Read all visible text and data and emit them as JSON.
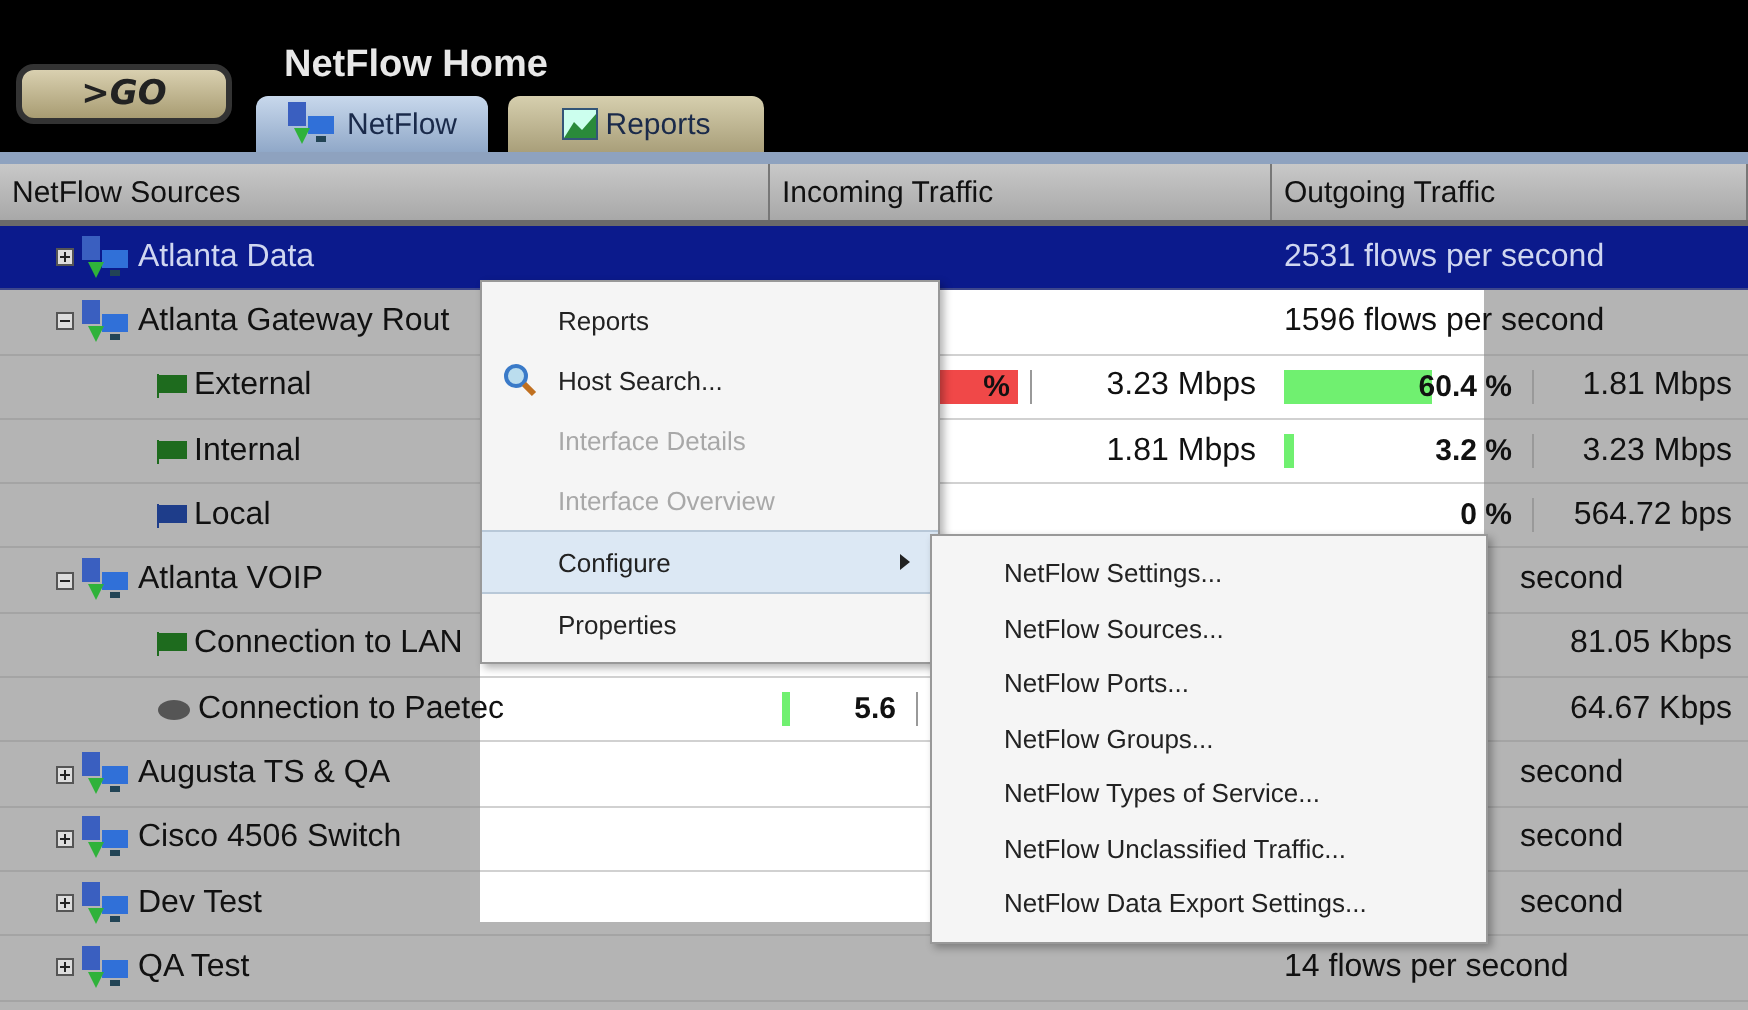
{
  "header": {
    "go_button": ">GO",
    "title": "NetFlow Home",
    "tabs": [
      {
        "label": "NetFlow",
        "selected": true
      },
      {
        "label": "Reports",
        "selected": false
      }
    ]
  },
  "table": {
    "columns": [
      "NetFlow Sources",
      "Incoming Traffic",
      "Outgoing Traffic"
    ],
    "rows": [
      {
        "kind": "group",
        "name": "Atlanta Data",
        "expanded": false,
        "selected": true,
        "outgoing_text": "2531 flows per second"
      },
      {
        "kind": "group",
        "name": "Atlanta Gateway Rout",
        "expanded": true,
        "selected": false,
        "outgoing_text": "1596 flows per second"
      },
      {
        "kind": "interface",
        "color": "#1e6b1e",
        "name": "External",
        "selected": false,
        "incoming": {
          "level": 0.95,
          "color": "#f04848",
          "percent": "%",
          "reading": "3.23 Mbps"
        },
        "outgoing": {
          "level": 0.6,
          "color": "#70f070",
          "percent": "60.4 %",
          "reading": "1.81 Mbps"
        }
      },
      {
        "kind": "interface",
        "color": "#1e6b1e",
        "name": "Internal",
        "selected": false,
        "incoming": {
          "reading": "1.81 Mbps"
        },
        "outgoing": {
          "level": 0.04,
          "color": "#70f070",
          "percent": "3.2 %",
          "reading": "3.23 Mbps"
        }
      },
      {
        "kind": "interface",
        "color": "#1e3d8a",
        "name": "Local",
        "selected": false,
        "outgoing": {
          "percent": "0 %",
          "reading": "564.72 bps"
        }
      },
      {
        "kind": "group",
        "name": "Atlanta VOIP",
        "expanded": true,
        "selected": false,
        "outgoing_text": "second"
      },
      {
        "kind": "interface",
        "color": "#1e6b1e",
        "name": "Connection to LAN",
        "selected": false,
        "outgoing": {
          "reading": "81.05 Kbps"
        }
      },
      {
        "kind": "link",
        "color": "#555555",
        "name": "Connection to Paetec",
        "selected": false,
        "incoming": {
          "level": 0.06,
          "color": "#70f070",
          "percent": "5.6"
        },
        "outgoing": {
          "reading": "64.67 Kbps"
        }
      },
      {
        "kind": "group",
        "name": "Augusta TS & QA",
        "expanded": false,
        "selected": false,
        "outgoing_text": "second"
      },
      {
        "kind": "group",
        "name": "Cisco 4506 Switch",
        "expanded": false,
        "selected": false,
        "outgoing_text": "second"
      },
      {
        "kind": "group",
        "name": "Dev Test",
        "expanded": false,
        "selected": false,
        "outgoing_text": "second"
      },
      {
        "kind": "group",
        "name": "QA Test",
        "expanded": false,
        "selected": false,
        "outgoing_text": "14 flows per second"
      }
    ]
  },
  "context_menu": {
    "items": [
      {
        "label": "Reports",
        "disabled": false,
        "selected": false,
        "submenu": false
      },
      {
        "label": "Host Search...",
        "disabled": false,
        "selected": false,
        "submenu": false
      },
      {
        "label": "Interface Details",
        "disabled": true,
        "selected": false,
        "submenu": false
      },
      {
        "label": "Interface Overview",
        "disabled": true,
        "selected": false,
        "submenu": false
      },
      {
        "label": "Configure",
        "disabled": false,
        "selected": true,
        "submenu": true
      },
      {
        "label": "Properties",
        "disabled": false,
        "selected": false,
        "submenu": false
      }
    ]
  },
  "submenu": {
    "items": [
      "NetFlow Settings...",
      "NetFlow Sources...",
      "NetFlow Ports...",
      "NetFlow Groups...",
      "NetFlow Types of Service...",
      "NetFlow Unclassified Traffic...",
      "NetFlow Data Export Settings..."
    ]
  }
}
